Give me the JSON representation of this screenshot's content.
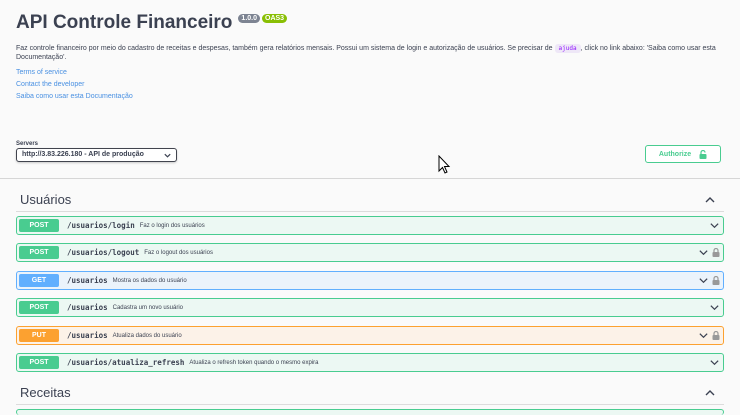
{
  "info": {
    "title": "API Controle Financeiro",
    "version": "1.0.0",
    "oas": "OAS3",
    "description_before": "Faz controle financeiro por meio do cadastro de receitas e despesas, também gera relatórios mensais. Possui um sistema de login e autorização de usuários. Se precisar de",
    "description_code": "ajuda",
    "description_after": ", click no link abaixo: 'Saiba como usar esta Documentação'.",
    "links": [
      "Terms of service",
      "Contact the developer",
      "Saiba como usar esta Documentação"
    ]
  },
  "servers": {
    "label": "Servers",
    "selected": "http://3.83.226.180 - API de produção"
  },
  "authorize_label": "Authorize",
  "tags": [
    {
      "name": "Usuários",
      "operations": [
        {
          "method": "POST",
          "path": "/usuarios/login",
          "summary": "Faz o login dos usuários",
          "locked": false
        },
        {
          "method": "POST",
          "path": "/usuarios/logout",
          "summary": "Faz o logout dos usuários",
          "locked": true
        },
        {
          "method": "GET",
          "path": "/usuarios",
          "summary": "Mostra os dados do usuário",
          "locked": true
        },
        {
          "method": "POST",
          "path": "/usuarios",
          "summary": "Cadastra um novo usuário",
          "locked": false
        },
        {
          "method": "PUT",
          "path": "/usuarios",
          "summary": "Atualiza dados do usuário",
          "locked": true
        },
        {
          "method": "POST",
          "path": "/usuarios/atualiza_refresh",
          "summary": "Atualiza o refresh token quando o mesmo expira",
          "locked": false
        }
      ]
    },
    {
      "name": "Receitas",
      "operations": []
    }
  ],
  "colors": {
    "post": "#49cc90",
    "get": "#61affe",
    "put": "#fca130"
  }
}
